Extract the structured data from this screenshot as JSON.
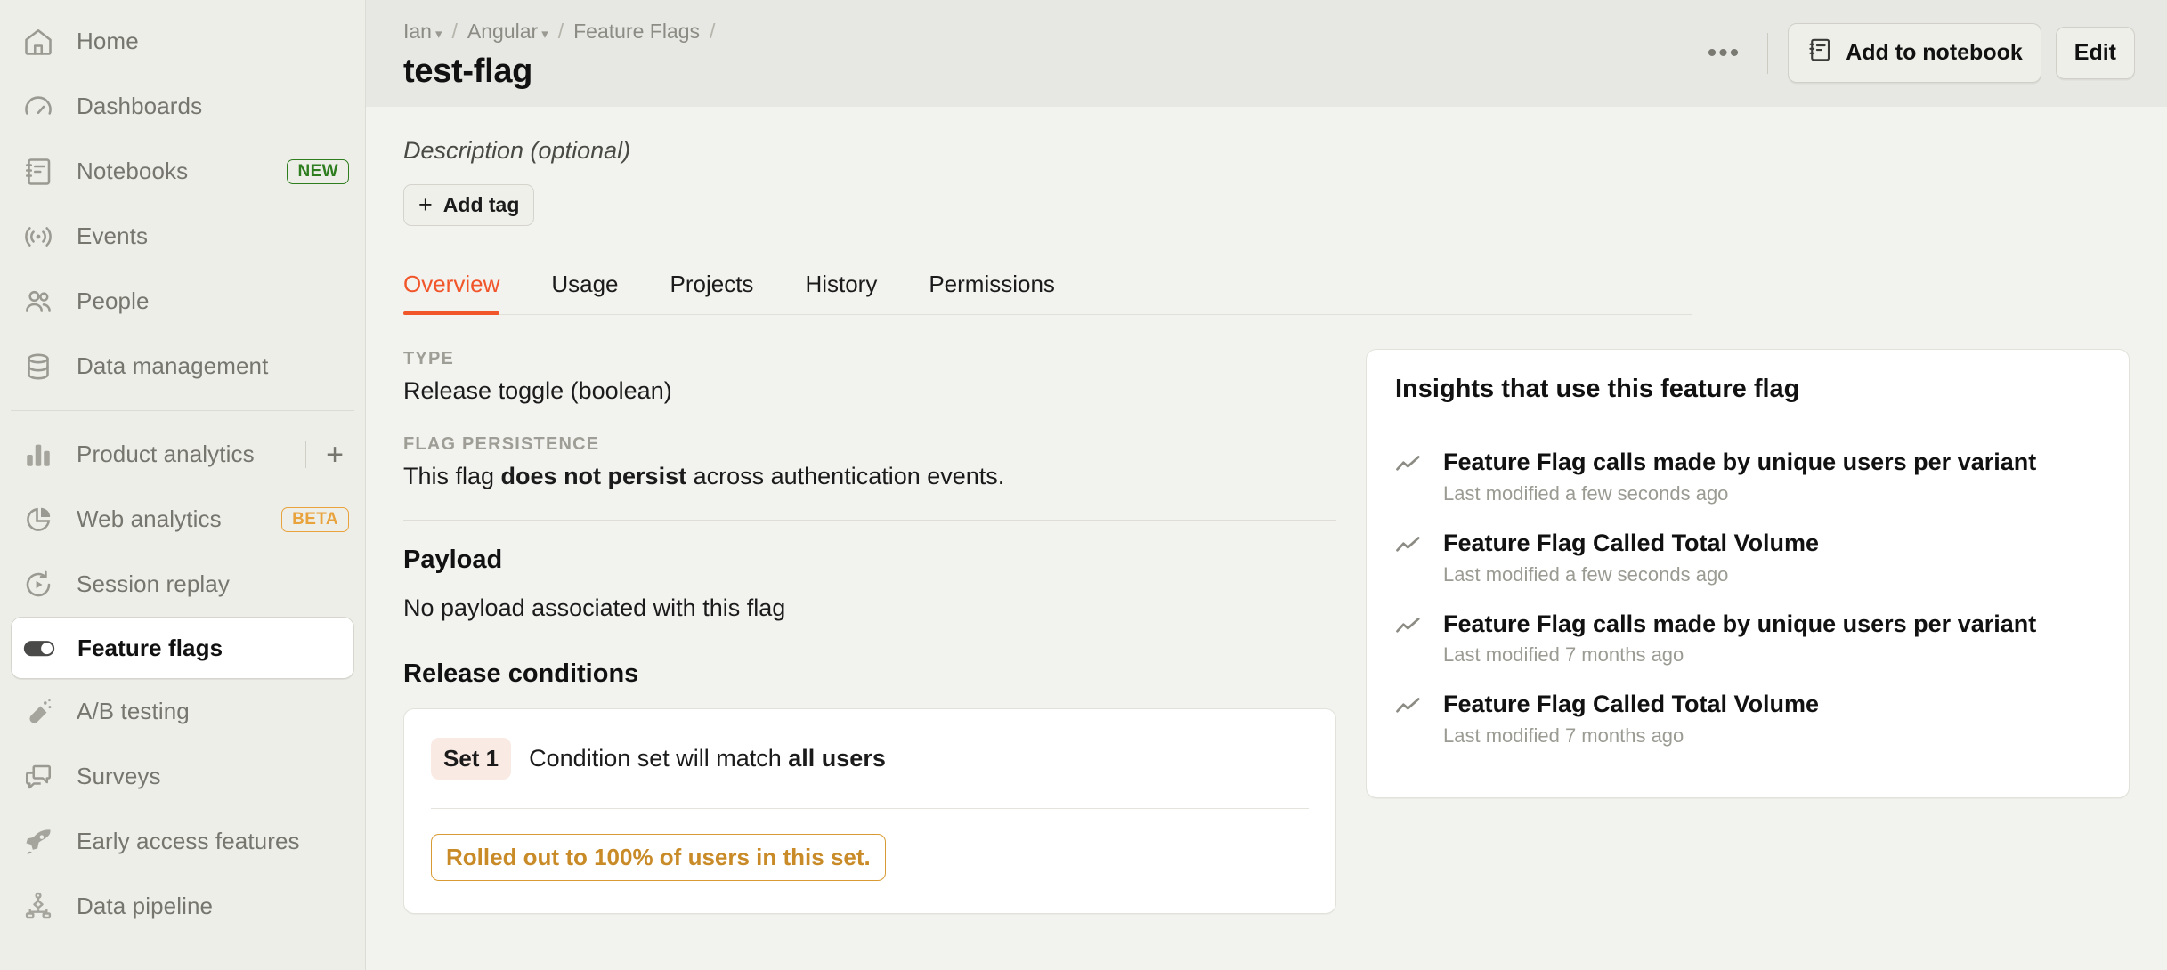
{
  "sidebar": {
    "items": [
      {
        "label": "Home",
        "icon": "home-icon",
        "badge": null
      },
      {
        "label": "Dashboards",
        "icon": "gauge-icon",
        "badge": null
      },
      {
        "label": "Notebooks",
        "icon": "notebook-icon",
        "badge": "NEW"
      },
      {
        "label": "Events",
        "icon": "broadcast-icon",
        "badge": null
      },
      {
        "label": "People",
        "icon": "people-icon",
        "badge": null
      },
      {
        "label": "Data management",
        "icon": "database-icon",
        "badge": null
      }
    ],
    "items2": [
      {
        "label": "Product analytics",
        "icon": "bar-chart-icon",
        "badge": null,
        "plus": "+"
      },
      {
        "label": "Web analytics",
        "icon": "pie-chart-icon",
        "badge": "BETA"
      },
      {
        "label": "Session replay",
        "icon": "replay-icon",
        "badge": null
      },
      {
        "label": "Feature flags",
        "icon": "toggle-icon",
        "badge": null,
        "active": true
      },
      {
        "label": "A/B testing",
        "icon": "flask-icon",
        "badge": null
      },
      {
        "label": "Surveys",
        "icon": "chat-icon",
        "badge": null
      },
      {
        "label": "Early access features",
        "icon": "rocket-icon",
        "badge": null
      },
      {
        "label": "Data pipeline",
        "icon": "pipeline-icon",
        "badge": null
      }
    ]
  },
  "topbar": {
    "breadcrumbs": [
      {
        "label": "Ian",
        "chevron": true
      },
      {
        "label": "Angular",
        "chevron": true
      },
      {
        "label": "Feature Flags",
        "chevron": false
      }
    ],
    "separator": "/",
    "title": "test-flag",
    "more_label": "•••",
    "add_to_notebook_label": "Add to notebook",
    "edit_label": "Edit"
  },
  "meta": {
    "description_placeholder": "Description (optional)",
    "add_tag_label": "Add tag"
  },
  "tabs": [
    {
      "label": "Overview",
      "active": true
    },
    {
      "label": "Usage",
      "active": false
    },
    {
      "label": "Projects",
      "active": false
    },
    {
      "label": "History",
      "active": false
    },
    {
      "label": "Permissions",
      "active": false
    }
  ],
  "overview": {
    "type_label": "TYPE",
    "type_value": "Release toggle (boolean)",
    "persistence_label": "FLAG PERSISTENCE",
    "persistence_prefix": "This flag ",
    "persistence_strong": "does not persist",
    "persistence_suffix": " across authentication events.",
    "payload_title": "Payload",
    "payload_text": "No payload associated with this flag",
    "release_conditions_title": "Release conditions",
    "set_badge": "Set 1",
    "condition_prefix": "Condition set will match ",
    "condition_strong": "all users",
    "rollout_text": "Rolled out to 100% of users in this set."
  },
  "insights": {
    "title": "Insights that use this feature flag",
    "items": [
      {
        "name": "Feature Flag calls made by unique users per variant",
        "meta": "Last modified a few seconds ago"
      },
      {
        "name": "Feature Flag Called Total Volume",
        "meta": "Last modified a few seconds ago"
      },
      {
        "name": "Feature Flag calls made by unique users per variant",
        "meta": "Last modified 7 months ago"
      },
      {
        "name": "Feature Flag Called Total Volume",
        "meta": "Last modified 7 months ago"
      }
    ]
  },
  "colors": {
    "accent": "#F1562A",
    "warning": "#C98B28",
    "new_badge": "#2E7D1F",
    "beta_badge": "#E8A33D",
    "sidebar_bg": "#EEEEE9",
    "content_bg": "#F2F2EF",
    "header_bg": "#E7E7E3"
  }
}
